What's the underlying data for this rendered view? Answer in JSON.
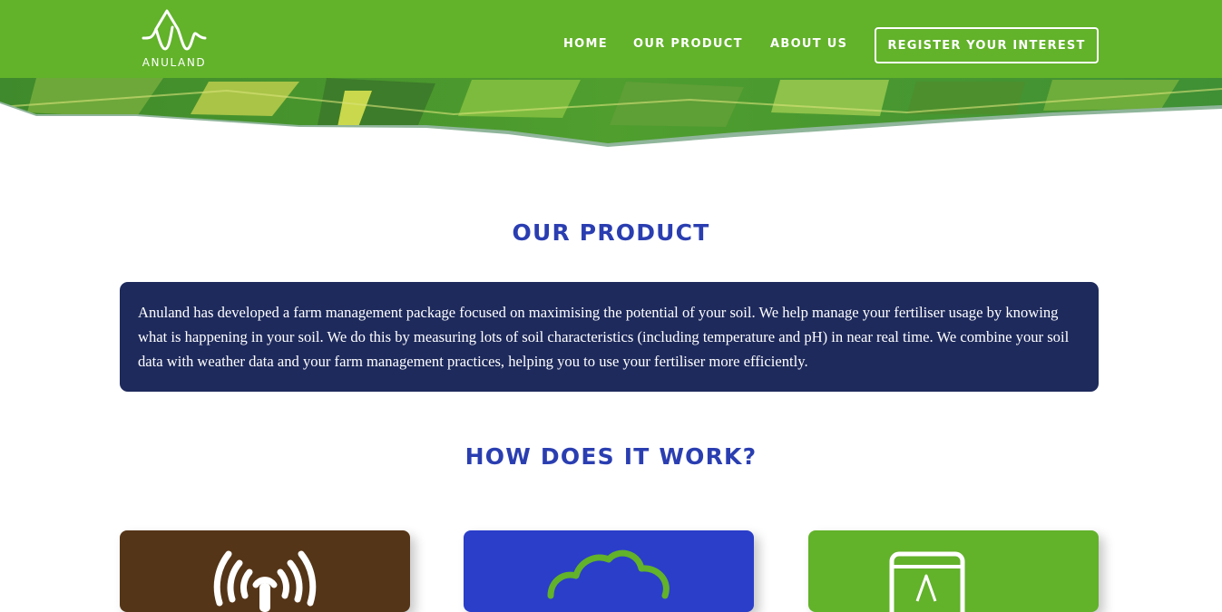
{
  "brand": {
    "name": "ANULAND",
    "logo_icon": "anuland-wave-logo"
  },
  "nav": {
    "items": [
      {
        "label": "HOME"
      },
      {
        "label": "OUR PRODUCT"
      },
      {
        "label": "ABOUT US"
      }
    ],
    "cta_label": "REGISTER YOUR INTEREST"
  },
  "sections": {
    "product": {
      "title": "OUR PRODUCT",
      "text": "Anuland has developed a farm management package focused on maximising the potential of your soil. We help manage your fertiliser usage by knowing what is happening in your soil. We do this by measuring lots of soil characteristics (including temperature and pH) in near real time. We combine your soil data with weather data and your farm management practices, helping you to use your fertiliser more efficiently."
    },
    "how": {
      "title": "HOW DOES IT WORK?",
      "cards": [
        {
          "icon": "wireless-signal-icon",
          "color": "#553517"
        },
        {
          "icon": "cloud-icon",
          "color": "#2a3ec9"
        },
        {
          "icon": "tablet-app-icon",
          "color": "#62b22a"
        }
      ]
    }
  },
  "colors": {
    "header_green": "#62b22a",
    "title_blue": "#2a3eb1",
    "intro_navy": "#1e2a5c"
  }
}
